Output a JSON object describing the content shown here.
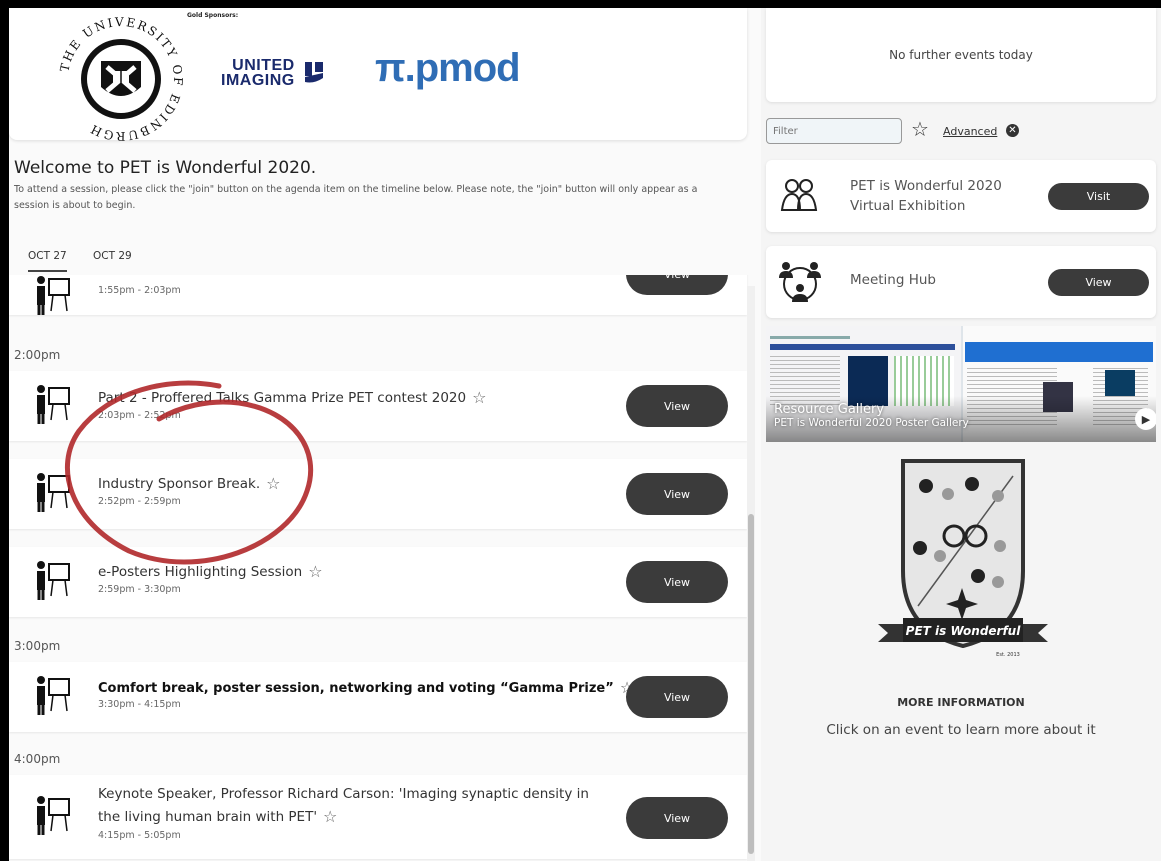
{
  "sponsors": {
    "gold_label": "Gold Sponsors:",
    "crest_ring_text": "THE UNIVERSITY OF EDINBURGH",
    "united_imaging_line1": "UNITED",
    "united_imaging_line2": "IMAGING",
    "pmod": "π.pmod"
  },
  "welcome": {
    "title": "Welcome to PET is Wonderful 2020.",
    "text": "To attend a session, please click the \"join\" button on the agenda item on the timeline below. Please note, the \"join\" button will only appear as a session is about to begin."
  },
  "tabs": [
    {
      "label": "OCT 27",
      "active": true
    },
    {
      "label": "OCT 29",
      "active": false
    }
  ],
  "timeline": {
    "hours": [
      "2:00pm",
      "3:00pm",
      "4:00pm"
    ],
    "events": [
      {
        "title": "",
        "time": "1:55pm - 2:03pm",
        "button": "View"
      },
      {
        "title": "Part 2 - Proffered Talks Gamma Prize PET contest 2020",
        "time": "2:03pm - 2:52pm",
        "button": "View"
      },
      {
        "title": "Industry Sponsor Break.",
        "time": "2:52pm - 2:59pm",
        "button": "View"
      },
      {
        "title": "e-Posters Highlighting Session",
        "time": "2:59pm - 3:30pm",
        "button": "View"
      },
      {
        "title": "Comfort break, poster session, networking and voting “Gamma Prize”",
        "time": "3:30pm - 4:15pm",
        "button": "View"
      },
      {
        "title_line1": "Keynote Speaker, Professor Richard Carson: 'Imaging synaptic density in",
        "title_line2": "the living human brain with PET'",
        "time": "4:15pm - 5:05pm",
        "button": "View"
      }
    ]
  },
  "sidebar": {
    "no_events": "No further events today",
    "filter_placeholder": "Filter",
    "advanced": "Advanced",
    "exhibition": {
      "line1": "PET is Wonderful 2020",
      "line2": "Virtual Exhibition",
      "button": "Visit"
    },
    "meeting_hub": {
      "label": "Meeting Hub",
      "button": "View"
    },
    "gallery": {
      "title": "Resource Gallery",
      "subtitle": "PET is Wonderful 2020 Poster Gallery"
    },
    "badge": {
      "banner": "PET is Wonderful",
      "est": "Est. 2013"
    },
    "more_info": {
      "heading": "MORE INFORMATION",
      "text": "Click on an event to learn more about it"
    }
  },
  "colors": {
    "button": "#3b3b3b",
    "annotation": "#b0282a",
    "pmod_blue": "#2f6db5"
  }
}
